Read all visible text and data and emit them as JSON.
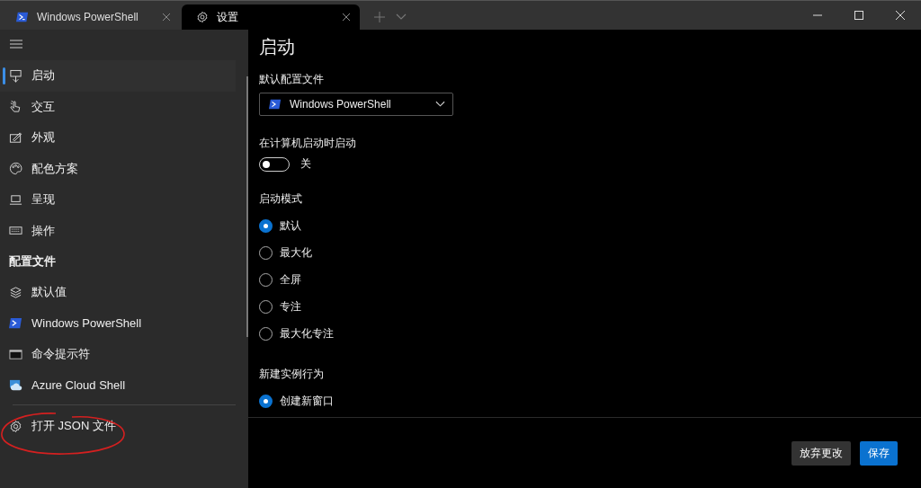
{
  "tabs": [
    {
      "label": "Windows PowerShell",
      "kind": "powershell",
      "selected": false
    },
    {
      "label": "设置",
      "kind": "gear",
      "selected": true
    }
  ],
  "sidebar": {
    "items": [
      {
        "label": "启动",
        "kind": "launch",
        "selected": true
      },
      {
        "label": "交互",
        "kind": "interaction",
        "selected": false
      },
      {
        "label": "外观",
        "kind": "appearance",
        "selected": false
      },
      {
        "label": "配色方案",
        "kind": "palette",
        "selected": false
      },
      {
        "label": "呈现",
        "kind": "rendering",
        "selected": false
      },
      {
        "label": "操作",
        "kind": "keyboard",
        "selected": false
      }
    ],
    "section_header": "配置文件",
    "profiles": [
      {
        "label": "默认值",
        "kind": "layers",
        "selected": false
      },
      {
        "label": "Windows PowerShell",
        "kind": "powershell",
        "selected": false
      },
      {
        "label": "命令提示符",
        "kind": "cmd",
        "selected": false
      },
      {
        "label": "Azure Cloud Shell",
        "kind": "azure",
        "selected": false
      }
    ],
    "footer_item": {
      "label": "打开 JSON 文件",
      "kind": "gear"
    },
    "annotation": {
      "kind": "ellipse"
    }
  },
  "page_title": "启动",
  "default_profile": {
    "label": "默认配置文件",
    "value": "Windows PowerShell"
  },
  "run_at_startup": {
    "label": "在计算机启动时启动",
    "on": false,
    "state_text": "关"
  },
  "launch_mode": {
    "label": "启动模式",
    "options": [
      {
        "label": "默认",
        "selected": true
      },
      {
        "label": "最大化",
        "selected": false
      },
      {
        "label": "全屏",
        "selected": false
      },
      {
        "label": "专注",
        "selected": false
      },
      {
        "label": "最大化专注",
        "selected": false
      }
    ]
  },
  "new_instance": {
    "label": "新建实例行为",
    "options": [
      {
        "label": "创建新窗口",
        "selected": true
      }
    ]
  },
  "buttons": [
    {
      "label": "放弃更改",
      "kind": "secondary"
    },
    {
      "label": "保存",
      "kind": "primary"
    }
  ]
}
